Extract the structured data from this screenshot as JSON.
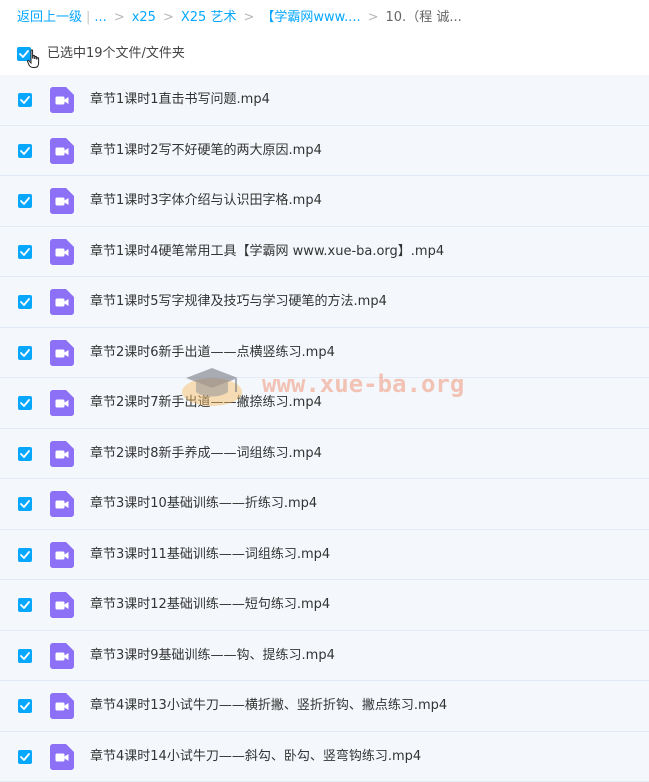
{
  "breadcrumb": {
    "back": "返回上一级",
    "ellipsis": "...",
    "items": [
      "x25",
      "X25 艺术",
      "【学霸网www....",
      "10.（程 诚..."
    ]
  },
  "selection": {
    "text": "已选中19个文件/文件夹"
  },
  "files": [
    {
      "name": "章节1课时1直击书写问题.mp4"
    },
    {
      "name": "章节1课时2写不好硬笔的两大原因.mp4"
    },
    {
      "name": "章节1课时3字体介绍与认识田字格.mp4"
    },
    {
      "name": "章节1课时4硬笔常用工具【学霸网 www.xue-ba.org】.mp4"
    },
    {
      "name": "章节1课时5写字规律及技巧与学习硬笔的方法.mp4"
    },
    {
      "name": "章节2课时6新手出道——点横竖练习.mp4"
    },
    {
      "name": "章节2课时7新手出道——撇捺练习.mp4"
    },
    {
      "name": "章节2课时8新手养成——词组练习.mp4"
    },
    {
      "name": "章节3课时10基础训练——折练习.mp4"
    },
    {
      "name": "章节3课时11基础训练——词组练习.mp4"
    },
    {
      "name": "章节3课时12基础训练——短句练习.mp4"
    },
    {
      "name": "章节3课时9基础训练——钩、提练习.mp4"
    },
    {
      "name": "章节4课时13小试牛刀——横折撇、竖折折钩、撇点练习.mp4"
    },
    {
      "name": "章节4课时14小试牛刀——斜勾、卧勾、竖弯钩练习.mp4"
    }
  ],
  "watermark": {
    "text": "www.xue-ba.org"
  },
  "colors": {
    "accent": "#06a7ff",
    "video_icon": "#8c70f5",
    "row_bg": "#f4f8fd"
  },
  "icons": {
    "checkbox": "checkbox-checked-icon",
    "file": "video-file-icon",
    "cursor": "hand-cursor-icon",
    "watermark": "graduation-cap-icon"
  }
}
